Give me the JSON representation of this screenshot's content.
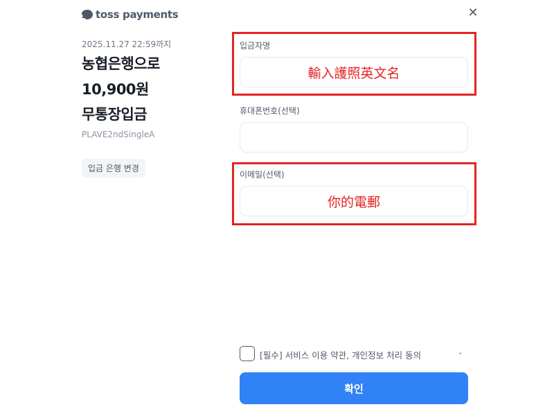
{
  "brand": {
    "logo_text": "toss payments"
  },
  "order": {
    "deadline": "2025.11.27 22:59까지",
    "bank_line": "농협은행으로",
    "amount": "10,900원",
    "method": "무통장입금",
    "order_name": "PLAVE2ndSingleA",
    "change_bank_label": "입금 은행 변경"
  },
  "form": {
    "depositor": {
      "label": "입금자명",
      "annotation": "輸入護照英文名",
      "value": ""
    },
    "phone": {
      "label": "휴대폰번호(선택)",
      "value": ""
    },
    "email": {
      "label": "이메일(선택)",
      "annotation": "你的電郵",
      "value": ""
    }
  },
  "agreement": {
    "label": "[필수] 서비스 이용 약관, 개인정보 처리 동의"
  },
  "confirm_label": "확인",
  "colors": {
    "accent": "#3182f6",
    "annotation_red": "#e52222"
  },
  "icons": {
    "close": "close-icon",
    "logo": "toss-logo-icon",
    "expand": "chevron-down-icon"
  }
}
